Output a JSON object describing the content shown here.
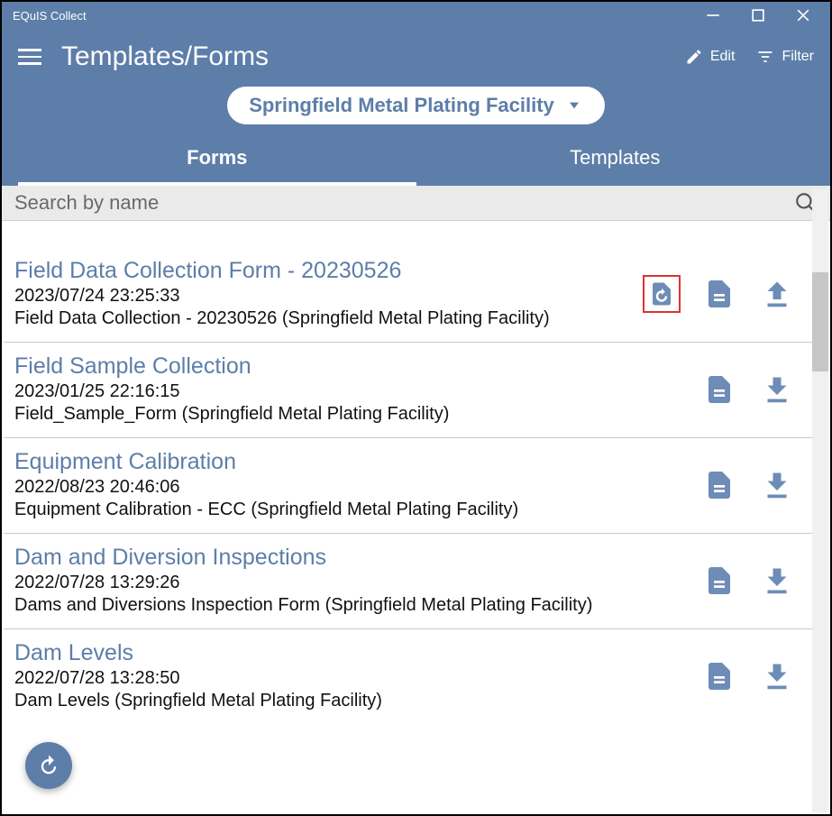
{
  "window": {
    "title": "EQuIS Collect"
  },
  "header": {
    "page_title": "Templates/Forms",
    "edit_label": "Edit",
    "filter_label": "Filter",
    "facility": "Springfield Metal Plating Facility"
  },
  "tabs": {
    "forms": "Forms",
    "templates": "Templates"
  },
  "search": {
    "placeholder": "Search by name"
  },
  "forms": [
    {
      "title": "Field Data Collection Form - 20230526",
      "date": "2023/07/24 23:25:33",
      "desc": "Field Data Collection - 20230526 (Springfield Metal Plating Facility)",
      "has_history": true,
      "action": "upload"
    },
    {
      "title": "Field Sample Collection",
      "date": "2023/01/25 22:16:15",
      "desc": "Field_Sample_Form (Springfield Metal Plating Facility)",
      "has_history": false,
      "action": "download"
    },
    {
      "title": "Equipment Calibration",
      "date": "2022/08/23 20:46:06",
      "desc": "Equipment Calibration - ECC (Springfield Metal Plating Facility)",
      "has_history": false,
      "action": "download"
    },
    {
      "title": "Dam and Diversion Inspections",
      "date": "2022/07/28 13:29:26",
      "desc": "Dams and Diversions Inspection Form (Springfield Metal Plating Facility)",
      "has_history": false,
      "action": "download"
    },
    {
      "title": "Dam Levels",
      "date": "2022/07/28 13:28:50",
      "desc": "Dam Levels (Springfield Metal Plating Facility)",
      "has_history": false,
      "action": "download"
    }
  ]
}
